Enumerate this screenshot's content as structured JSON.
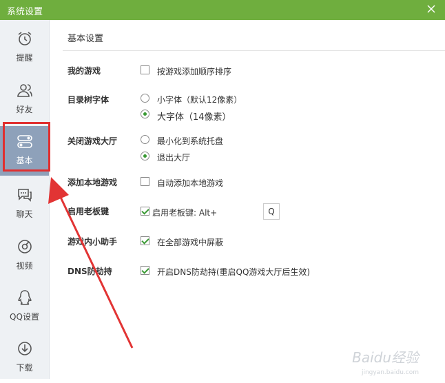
{
  "window": {
    "title": "系统设置"
  },
  "sidebar": {
    "items": [
      {
        "label": "提醒",
        "icon": "alarm-clock-icon"
      },
      {
        "label": "好友",
        "icon": "friends-icon"
      },
      {
        "label": "基本",
        "icon": "toggle-settings-icon",
        "active": true
      },
      {
        "label": "聊天",
        "icon": "chat-icon"
      },
      {
        "label": "视频",
        "icon": "video-icon"
      },
      {
        "label": "QQ设置",
        "icon": "qq-penguin-icon"
      },
      {
        "label": "下载",
        "icon": "download-icon"
      }
    ]
  },
  "main": {
    "section_title": "基本设置",
    "settings": {
      "my_games": {
        "label": "我的游戏",
        "option": "按游戏添加顺序排序",
        "checked": false
      },
      "tree_font": {
        "label": "目录树字体",
        "options": [
          {
            "text": "小字体（默认12像素）",
            "selected": false
          },
          {
            "text": "大字体（14像素）",
            "selected": true
          }
        ]
      },
      "close_lobby": {
        "label": "关闭游戏大厅",
        "options": [
          {
            "text": "最小化到系统托盘",
            "selected": false
          },
          {
            "text": "退出大厅",
            "selected": true
          }
        ]
      },
      "add_local": {
        "label": "添加本地游戏",
        "option": "自动添加本地游戏",
        "checked": false
      },
      "boss_key": {
        "label": "启用老板键",
        "option": "启用老板键: Alt+",
        "checked": true,
        "key": "Q"
      },
      "helper": {
        "label": "游戏内小助手",
        "option": "在全部游戏中屏蔽",
        "checked": true
      },
      "dns": {
        "label": "DNS防劫持",
        "option": "开启DNS防劫持(重启QQ游戏大厅后生效)",
        "checked": true
      }
    }
  },
  "watermark": {
    "text": "Baidu经验",
    "sub": "jingyan.baidu.com"
  },
  "colors": {
    "titlebar": "#6fae3e",
    "sidebar_bg": "#eef1f4",
    "active_item": "#8ea1ba",
    "highlight": "#e02f2f",
    "check": "#3a9a34"
  }
}
